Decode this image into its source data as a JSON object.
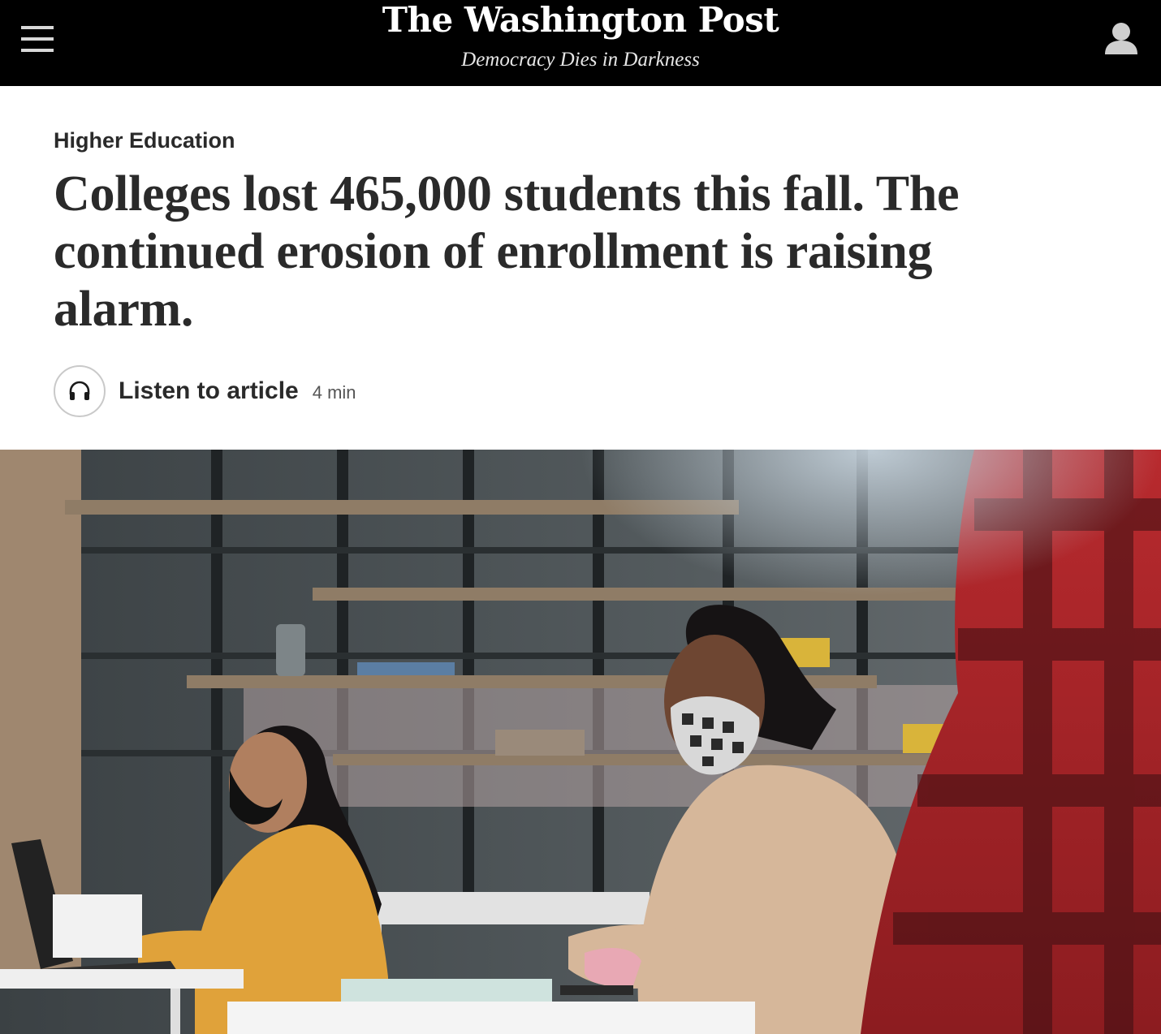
{
  "masthead": {
    "logo_text": "The Washington Post",
    "tagline": "Democracy Dies in Darkness",
    "menu_icon": "hamburger-menu-icon",
    "account_icon": "user-account-icon",
    "background_color": "#000000"
  },
  "article": {
    "section": "Higher Education",
    "headline": "Colleges lost 465,000 students this fall. The continued erosion of enrollment is raising alarm."
  },
  "listen": {
    "label": "Listen to article",
    "duration": "4 min",
    "icon": "headphones-icon"
  },
  "lead_image": {
    "description_icon": "photo"
  }
}
